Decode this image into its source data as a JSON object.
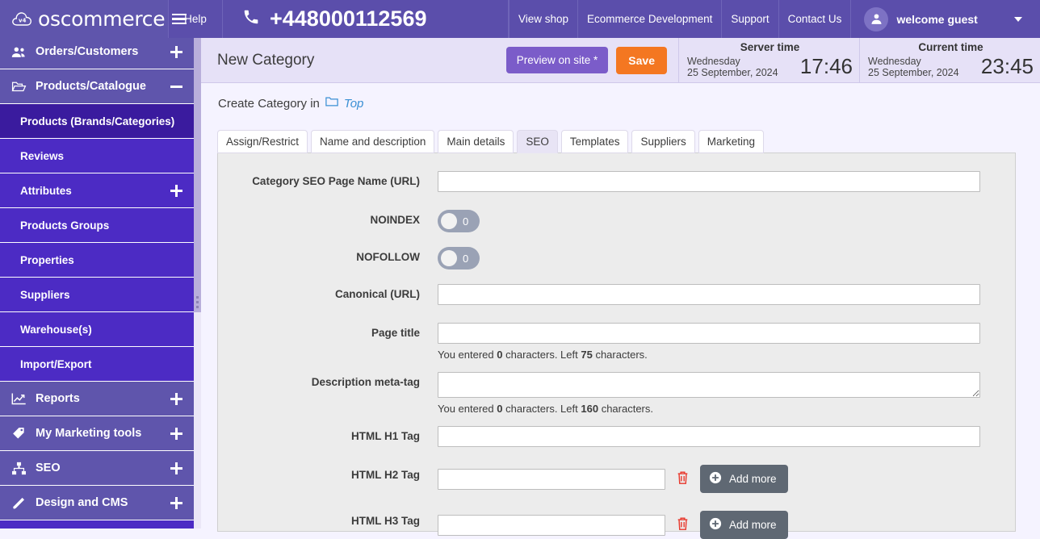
{
  "header": {
    "brand_name": "oscommerce",
    "brand_badge": "v4",
    "menu_icon": "hamburger-icon",
    "help_label": "Help",
    "phone_icon": "phone-icon",
    "phone_number": "+448000112569",
    "nav_links": [
      {
        "label": "View shop"
      },
      {
        "label": "Ecommerce Development"
      },
      {
        "label": "Support"
      },
      {
        "label": "Contact Us"
      }
    ],
    "user": {
      "label": "welcome guest",
      "avatar_icon": "user-icon",
      "caret_icon": "chevron-down-icon"
    },
    "bg_color": "#5b4eab"
  },
  "sidebar": {
    "items": [
      {
        "label": "Orders/Customers",
        "icon": "users-icon",
        "type": "group",
        "toggle": "plus",
        "active": false
      },
      {
        "label": "Products/Catalogue",
        "icon": "folder-open-icon",
        "type": "group",
        "toggle": "minus",
        "active": false
      },
      {
        "label": "Products (Brands/Categories)",
        "type": "sub",
        "toggle": "",
        "active": true
      },
      {
        "label": "Reviews",
        "type": "sub",
        "toggle": "",
        "active": false
      },
      {
        "label": "Attributes",
        "type": "sub",
        "toggle": "plus",
        "active": false
      },
      {
        "label": "Products Groups",
        "type": "sub",
        "toggle": "",
        "active": false
      },
      {
        "label": "Properties",
        "type": "sub",
        "toggle": "",
        "active": false
      },
      {
        "label": "Suppliers",
        "type": "sub",
        "toggle": "",
        "active": false
      },
      {
        "label": "Warehouse(s)",
        "type": "sub",
        "toggle": "",
        "active": false
      },
      {
        "label": "Import/Export",
        "type": "sub",
        "toggle": "",
        "active": false
      },
      {
        "label": "Reports",
        "icon": "chart-line-icon",
        "type": "group",
        "toggle": "plus",
        "active": false
      },
      {
        "label": "My Marketing tools",
        "icon": "tags-icon",
        "type": "group",
        "toggle": "plus",
        "active": false
      },
      {
        "label": "SEO",
        "icon": "sitemap-icon",
        "type": "group",
        "toggle": "plus",
        "active": false
      },
      {
        "label": "Design and CMS",
        "icon": "pencil-icon",
        "type": "group",
        "toggle": "plus",
        "active": false
      }
    ],
    "bg_color": "#4c2bc4",
    "active_color": "#3a1b9e"
  },
  "titlebar": {
    "page_title": "New Category",
    "preview_label": "Preview on site *",
    "save_label": "Save",
    "save_color": "#f47721",
    "server_time": {
      "heading": "Server time",
      "day": "Wednesday",
      "date": "25 September, 2024",
      "clock": "17:46"
    },
    "current_time": {
      "heading": "Current time",
      "day": "Wednesday",
      "date": "25 September, 2024",
      "clock": "23:45"
    }
  },
  "breadcrumb": {
    "prefix": "Create Category in",
    "folder_icon": "folder-icon",
    "link": "Top"
  },
  "tabs": [
    {
      "label": "Assign/Restrict",
      "active": false
    },
    {
      "label": "Name and description",
      "active": false
    },
    {
      "label": "Main details",
      "active": false
    },
    {
      "label": "SEO",
      "active": true
    },
    {
      "label": "Templates",
      "active": false
    },
    {
      "label": "Suppliers",
      "active": false
    },
    {
      "label": "Marketing",
      "active": false
    }
  ],
  "form": {
    "seo_page_name": {
      "label": "Category SEO Page Name (URL)",
      "value": "",
      "placeholder": ""
    },
    "noindex": {
      "label": "NOINDEX",
      "state": "0"
    },
    "nofollow": {
      "label": "NOFOLLOW",
      "state": "0"
    },
    "canonical": {
      "label": "Canonical (URL)",
      "value": "",
      "placeholder": ""
    },
    "page_title": {
      "label": "Page title",
      "value": "",
      "placeholder": "",
      "counter_pre": "You entered",
      "counter_entered": "0",
      "counter_mid": "characters. Left",
      "counter_left": "75",
      "counter_post": "characters."
    },
    "description_meta": {
      "label": "Description meta-tag",
      "value": "",
      "placeholder": "",
      "counter_pre": "You entered",
      "counter_entered": "0",
      "counter_mid": "characters. Left",
      "counter_left": "160",
      "counter_post": "characters."
    },
    "h1_tag": {
      "label": "HTML H1 Tag",
      "value": "",
      "placeholder": ""
    },
    "h2_tag": {
      "label": "HTML H2 Tag",
      "value": "",
      "placeholder": "",
      "delete_icon": "trash-icon",
      "add_more_label": "Add more",
      "add_more_icon": "plus-circle-icon"
    },
    "h3_tag": {
      "label": "HTML H3 Tag",
      "value": "",
      "placeholder": "",
      "delete_icon": "trash-icon",
      "add_more_label": "Add more",
      "add_more_icon": "plus-circle-icon"
    }
  }
}
